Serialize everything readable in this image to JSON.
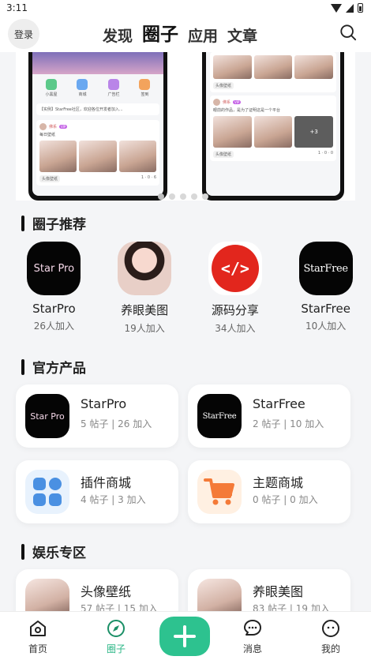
{
  "status": {
    "time": "3:11"
  },
  "header": {
    "login_label": "登录",
    "tabs": [
      {
        "label": "发现"
      },
      {
        "label": "圈子"
      },
      {
        "label": "应用"
      },
      {
        "label": "文章"
      }
    ],
    "active_tab": "圈子"
  },
  "banner": {
    "quick_entries": [
      "小黑屋",
      "商城",
      "广告栏",
      "签到"
    ],
    "notice": "【实例】StarFree社区，欢迎各位开发者加入...",
    "card1": {
      "user": "佛系",
      "vip": "VIP",
      "text": "每日壁纸",
      "tag": "头像壁纸",
      "stats": [
        "1",
        "0",
        "6"
      ]
    },
    "card2": {
      "tag_top": "头像壁纸",
      "user": "佛系",
      "vip": "VIP",
      "text": "眼前的作品，是为了证明这是一个平台",
      "more": "+3",
      "tag": "头像壁纸",
      "stats": [
        "1",
        "0",
        "0"
      ]
    },
    "page_count": 5,
    "active_page": 1
  },
  "recommend": {
    "title": "圈子推荐",
    "items": [
      {
        "name": "StarPro",
        "count": "26人加入",
        "logo_text": "Star Pro"
      },
      {
        "name": "养眼美图",
        "count": "19人加入"
      },
      {
        "name": "源码分享",
        "count": "34人加入",
        "logo_text": "</>"
      },
      {
        "name": "StarFree",
        "count": "10人加入",
        "logo_text": "StarFree"
      }
    ]
  },
  "official": {
    "title": "官方产品",
    "items": [
      {
        "name": "StarPro",
        "meta": "5 帖子 | 26 加入",
        "logo_text": "Star Pro"
      },
      {
        "name": "StarFree",
        "meta": "2 帖子 | 10 加入",
        "logo_text": "StarFree"
      },
      {
        "name": "插件商城",
        "meta": "4 帖子 | 3 加入"
      },
      {
        "name": "主题商城",
        "meta": "0 帖子 | 0 加入"
      }
    ]
  },
  "entertainment": {
    "title": "娱乐专区",
    "items": [
      {
        "name": "头像壁纸",
        "meta": "57 帖子 | 15 加入"
      },
      {
        "name": "养眼美图",
        "meta": "83 帖子 | 19 加入"
      }
    ]
  },
  "bottom_nav": {
    "items": [
      {
        "label": "首页",
        "icon": "home-icon"
      },
      {
        "label": "圈子",
        "icon": "compass-icon"
      },
      {
        "label": "消息",
        "icon": "message-icon"
      },
      {
        "label": "我的",
        "icon": "profile-icon"
      }
    ],
    "active": "圈子"
  },
  "colors": {
    "accent": "#2dc28f",
    "code_red": "#e2261d",
    "plugin_blue": "#4a90e2",
    "cart_orange": "#f47a38"
  }
}
